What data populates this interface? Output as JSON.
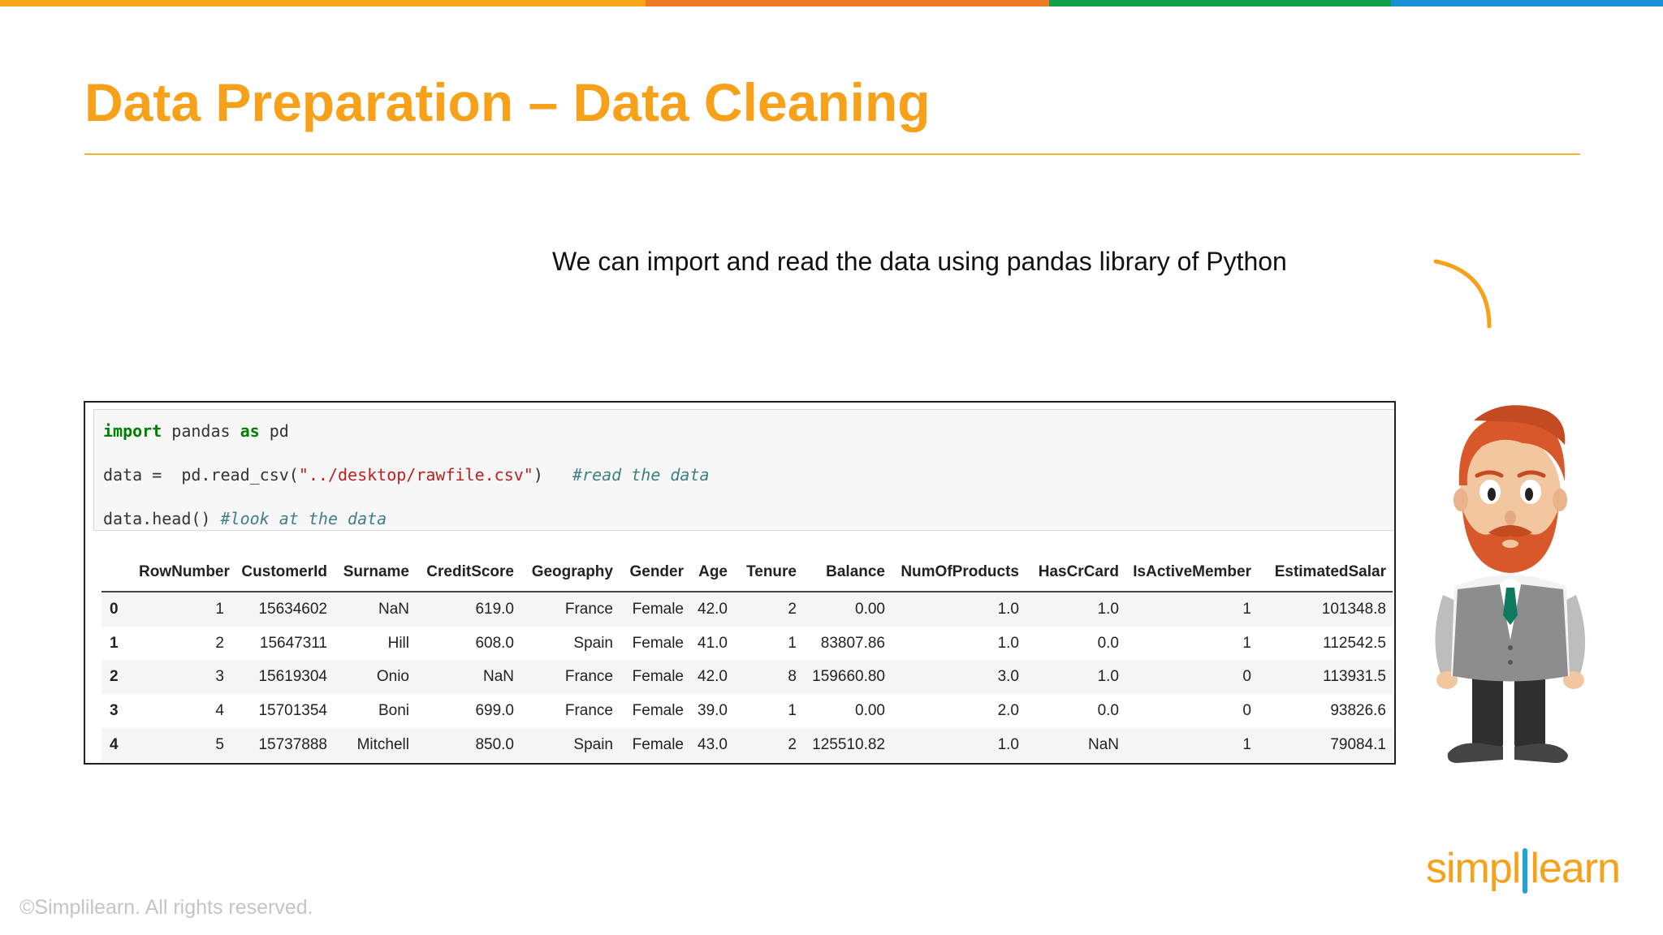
{
  "colors": {
    "accent": "#f7a11a",
    "topbar": [
      "#f9a51a",
      "#ef7a24",
      "#13a04a",
      "#1a8fd3"
    ]
  },
  "slide": {
    "title": "Data Preparation – Data Cleaning",
    "subtitle": "We can import and read the data using pandas library of Python"
  },
  "code": {
    "line1": {
      "kw1": "import",
      "mid": " pandas ",
      "kw2": "as",
      "end": " pd"
    },
    "line2": {
      "prefix": "data =  pd.read_csv(",
      "string": "\"../desktop/rawfile.csv\"",
      "suffix": ")   ",
      "comment": "#read the data"
    },
    "line3": {
      "prefix": "data.head() ",
      "comment": "#look at the data"
    }
  },
  "table": {
    "columns": [
      "",
      "RowNumber",
      "CustomerId",
      "Surname",
      "CreditScore",
      "Geography",
      "Gender",
      "Age",
      "Tenure",
      "Balance",
      "NumOfProducts",
      "HasCrCard",
      "IsActiveMember",
      "EstimatedSalar"
    ],
    "rows": [
      [
        "0",
        "1",
        "15634602",
        "NaN",
        "619.0",
        "France",
        "Female",
        "42.0",
        "2",
        "0.00",
        "1.0",
        "1.0",
        "1",
        "101348.8"
      ],
      [
        "1",
        "2",
        "15647311",
        "Hill",
        "608.0",
        "Spain",
        "Female",
        "41.0",
        "1",
        "83807.86",
        "1.0",
        "0.0",
        "1",
        "112542.5"
      ],
      [
        "2",
        "3",
        "15619304",
        "Onio",
        "NaN",
        "France",
        "Female",
        "42.0",
        "8",
        "159660.80",
        "3.0",
        "1.0",
        "0",
        "113931.5"
      ],
      [
        "3",
        "4",
        "15701354",
        "Boni",
        "699.0",
        "France",
        "Female",
        "39.0",
        "1",
        "0.00",
        "2.0",
        "0.0",
        "0",
        "93826.6"
      ],
      [
        "4",
        "5",
        "15737888",
        "Mitchell",
        "850.0",
        "Spain",
        "Female",
        "43.0",
        "2",
        "125510.82",
        "1.0",
        "NaN",
        "1",
        "79084.1"
      ]
    ]
  },
  "logo": {
    "left": "simpl",
    "right": "learn"
  },
  "footer": {
    "copyright": "©Simplilearn. All rights reserved."
  }
}
